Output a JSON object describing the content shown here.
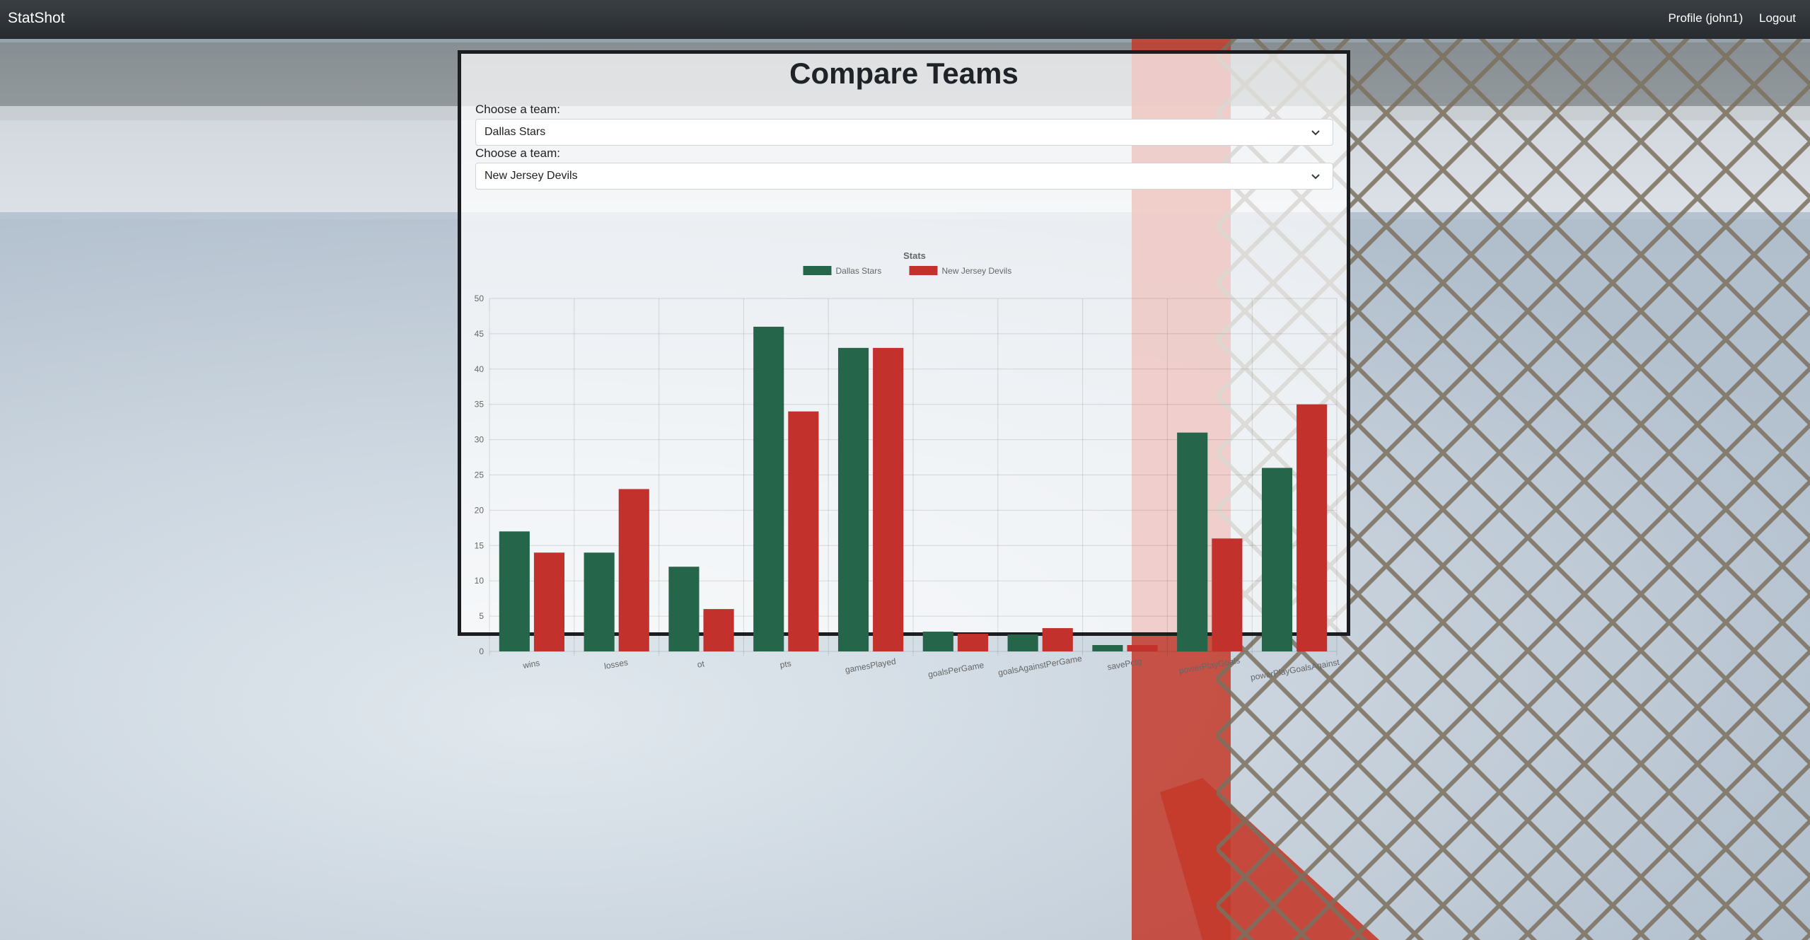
{
  "navbar": {
    "brand": "StatShot",
    "profile_label": "Profile (john1)",
    "logout_label": "Logout"
  },
  "page": {
    "title": "Compare Teams"
  },
  "form": {
    "team1_label": "Choose a team:",
    "team1_value": "Dallas Stars",
    "team2_label": "Choose a team:",
    "team2_value": "New Jersey Devils"
  },
  "colors": {
    "series1": "#25654a",
    "series2": "#c3312d",
    "navbar": "#2b2f33"
  },
  "chart_data": {
    "type": "bar",
    "title": "Stats",
    "categories": [
      "wins",
      "losses",
      "ot",
      "pts",
      "gamesPlayed",
      "goalsPerGame",
      "goalsAgainstPerGame",
      "savePctg",
      "powerPlayGoals",
      "powerPlayGoalsAgainst"
    ],
    "series": [
      {
        "name": "Dallas Stars",
        "values": [
          17,
          14,
          12,
          46,
          43,
          2.8,
          2.4,
          0.9,
          31,
          26
        ]
      },
      {
        "name": "New Jersey Devils",
        "values": [
          14,
          23,
          6,
          34,
          43,
          2.5,
          3.3,
          0.9,
          16,
          35
        ]
      }
    ],
    "ylim": [
      0,
      50
    ],
    "yticks": [
      0,
      5,
      10,
      15,
      20,
      25,
      30,
      35,
      40,
      45,
      50
    ],
    "legend": "top-center",
    "grid": true
  }
}
